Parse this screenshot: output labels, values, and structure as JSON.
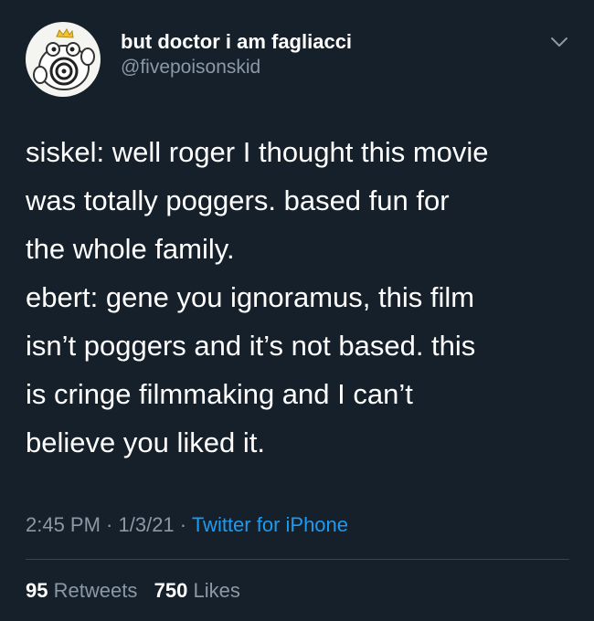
{
  "user": {
    "display_name": "but doctor i am fagliacci",
    "handle": "@fivepoisonskid",
    "avatar_icon": "poliwrath-avatar-icon"
  },
  "tweet": {
    "lines": [
      "siskel: well roger I thought this movie",
      "was totally poggers. based fun for",
      "the whole family.",
      "ebert: gene you ignoramus, this film",
      "isn’t poggers and it’s not based. this",
      "is cringe filmmaking and I can’t",
      "believe you liked it."
    ]
  },
  "meta": {
    "time": "2:45 PM",
    "separator": " · ",
    "date": "1/3/21",
    "source": "Twitter for iPhone"
  },
  "stats": {
    "retweets_count": "95",
    "retweets_label": "Retweets",
    "likes_count": "750",
    "likes_label": "Likes"
  },
  "colors": {
    "background": "#15202b",
    "text": "#ffffff",
    "secondary": "#8b98a5",
    "accent": "#1d9bf0",
    "divider": "#38444d"
  }
}
